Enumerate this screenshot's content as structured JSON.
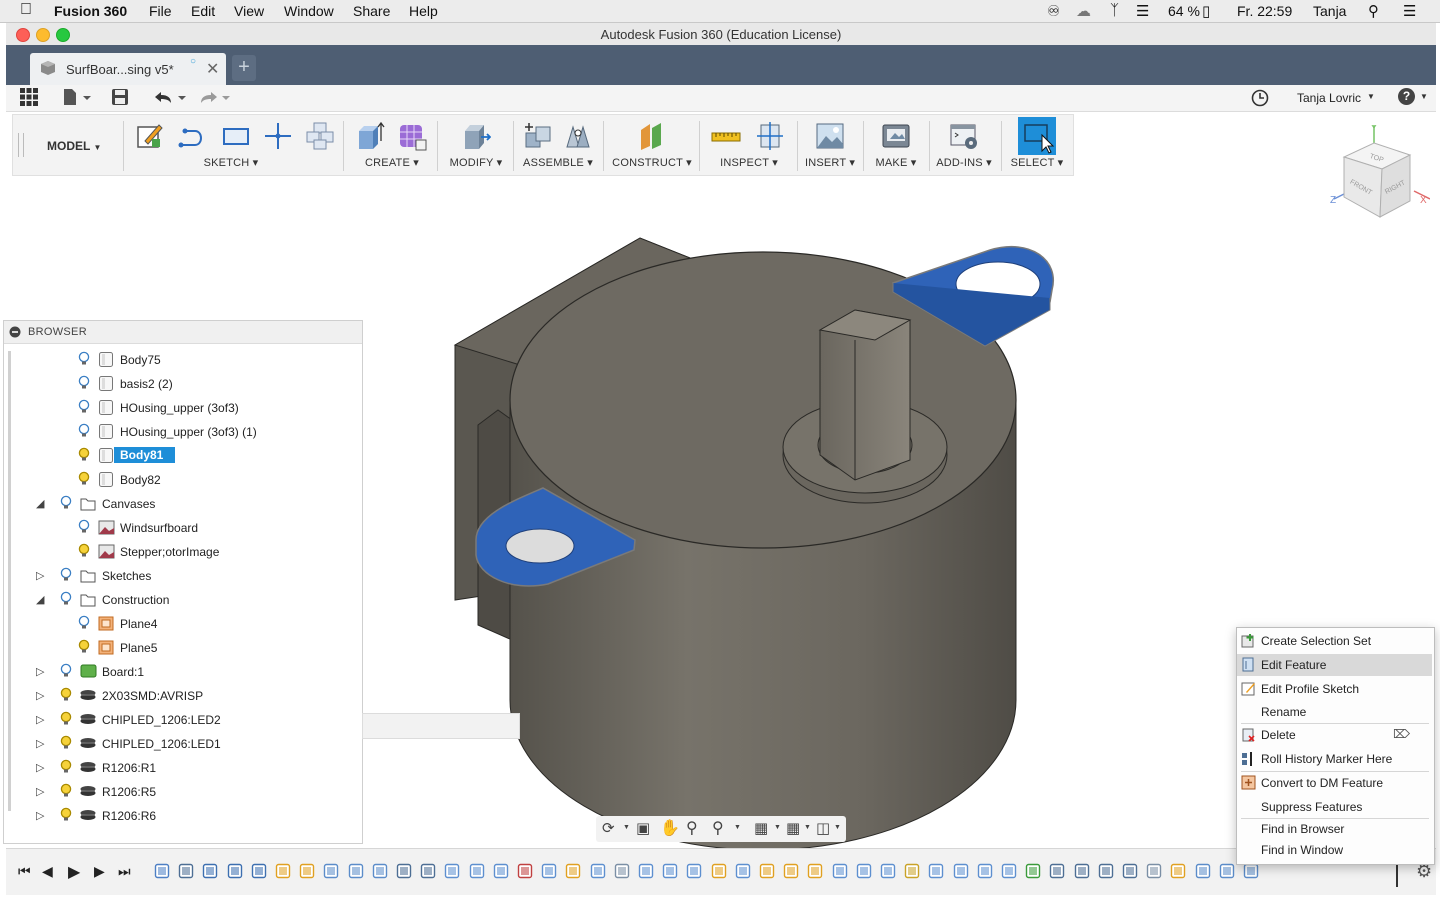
{
  "menubar": {
    "app": "Fusion 360",
    "items": [
      "File",
      "Edit",
      "View",
      "Window",
      "Share",
      "Help"
    ],
    "battery": "64 %",
    "clock": "Fr. 22:59",
    "user": "Tanja"
  },
  "window": {
    "title": "Autodesk Fusion 360 (Education License)"
  },
  "tab": {
    "label": "SurfBoar...sing v5*"
  },
  "quickaccess": {
    "user": "Tanja Lovric",
    "help": "?"
  },
  "toolbar": {
    "workspace": "MODEL",
    "groups": [
      "SKETCH",
      "CREATE",
      "MODIFY",
      "ASSEMBLE",
      "CONSTRUCT",
      "INSPECT",
      "INSERT",
      "MAKE",
      "ADD-INS",
      "SELECT"
    ]
  },
  "viewcube": {
    "top": "TOP",
    "front": "FRONT",
    "right": "RIGHT",
    "x": "X",
    "y": "Y",
    "z": "Z"
  },
  "browser": {
    "title": "BROWSER",
    "items": [
      {
        "label": "Body75",
        "icon": "body-icon",
        "bulb": "blue"
      },
      {
        "label": "basis2 (2)",
        "icon": "body-icon",
        "bulb": "blue"
      },
      {
        "label": "HOusing_upper  (3of3)",
        "icon": "body-icon",
        "bulb": "blue"
      },
      {
        "label": "HOusing_upper  (3of3) (1)",
        "icon": "body-icon",
        "bulb": "blue"
      },
      {
        "label": "Body81",
        "icon": "body-icon",
        "bulb": "yellow",
        "selected": true
      },
      {
        "label": "Body82",
        "icon": "body-icon",
        "bulb": "yellow"
      },
      {
        "label": "Canvases",
        "icon": "folder-icon",
        "bulb": "blue",
        "expander": "open"
      },
      {
        "label": "Windsurfboard",
        "icon": "canvas-icon",
        "bulb": "blue"
      },
      {
        "label": "Stepper;otorImage",
        "icon": "canvas-icon",
        "bulb": "yellow"
      },
      {
        "label": "Sketches",
        "icon": "folder-icon",
        "bulb": "blue",
        "expander": "closed"
      },
      {
        "label": "Construction",
        "icon": "folder-icon",
        "bulb": "blue",
        "expander": "open"
      },
      {
        "label": "Plane4",
        "icon": "plane-icon",
        "bulb": "blue"
      },
      {
        "label": "Plane5",
        "icon": "plane-icon",
        "bulb": "yellow"
      },
      {
        "label": "Board:1",
        "icon": "board-icon",
        "bulb": "blue",
        "expander": "closed"
      },
      {
        "label": "2X03SMD:AVRISP",
        "icon": "component-icon",
        "bulb": "yellow",
        "expander": "closed"
      },
      {
        "label": "CHIPLED_1206:LED2",
        "icon": "component-icon",
        "bulb": "yellow",
        "expander": "closed"
      },
      {
        "label": "CHIPLED_1206:LED1",
        "icon": "component-icon",
        "bulb": "yellow",
        "expander": "closed"
      },
      {
        "label": "R1206:R1",
        "icon": "component-icon",
        "bulb": "yellow",
        "expander": "closed"
      },
      {
        "label": "R1206:R5",
        "icon": "component-icon",
        "bulb": "yellow",
        "expander": "closed"
      },
      {
        "label": "R1206:R6",
        "icon": "component-icon",
        "bulb": "yellow",
        "expander": "closed"
      }
    ]
  },
  "context_menu": {
    "items": [
      {
        "label": "Create Selection Set",
        "icon": "selection-set-icon"
      },
      {
        "label": "Edit Feature",
        "icon": "edit-feature-icon",
        "highlighted": true
      },
      {
        "label": "Edit Profile Sketch",
        "icon": "edit-sketch-icon"
      },
      {
        "label": "Rename",
        "icon": ""
      },
      {
        "label": "Delete",
        "icon": "delete-icon"
      },
      {
        "label": "Roll History Marker Here",
        "icon": "roll-history-icon"
      },
      {
        "label": "Convert to DM Feature",
        "icon": "convert-icon"
      },
      {
        "label": "Suppress Features",
        "icon": ""
      },
      {
        "label": "Find in Browser",
        "icon": ""
      },
      {
        "label": "Find in Window",
        "icon": ""
      }
    ]
  },
  "colors": {
    "tabbar": "#4e5e73",
    "selection": "#1e8ed8",
    "body": "#6e6a62",
    "tabs_blue": "#2f63b8"
  }
}
